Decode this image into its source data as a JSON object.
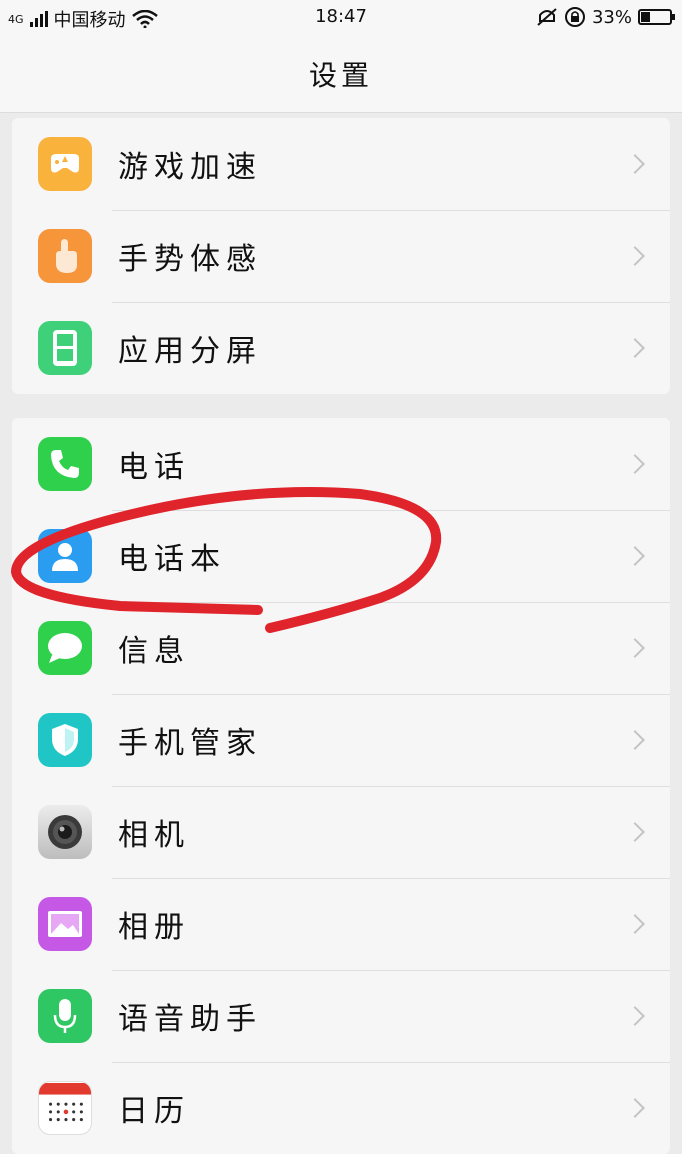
{
  "status": {
    "network": "4G",
    "carrier": "中国移动",
    "time": "18:47",
    "battery": "33%",
    "battery_level": 0.33
  },
  "nav": {
    "title": "设置"
  },
  "groups": [
    {
      "items": [
        {
          "label": "游戏加速",
          "icon": "game-rocket-icon",
          "color": "#f9b23c"
        },
        {
          "label": "手势体感",
          "icon": "hand-gesture-icon",
          "color": "#f7953b"
        },
        {
          "label": "应用分屏",
          "icon": "split-screen-icon",
          "color": "#3ed17a"
        }
      ]
    },
    {
      "items": [
        {
          "label": "电话",
          "icon": "phone-icon",
          "color": "#2fd04c"
        },
        {
          "label": "电话本",
          "icon": "contacts-icon",
          "color": "#2b9df0"
        },
        {
          "label": "信息",
          "icon": "message-icon",
          "color": "#2fd04c"
        },
        {
          "label": "手机管家",
          "icon": "shield-icon",
          "color": "#20c6c6"
        },
        {
          "label": "相机",
          "icon": "camera-icon",
          "color": "#c9c9c9"
        },
        {
          "label": "相册",
          "icon": "gallery-icon",
          "color": "#c658e6"
        },
        {
          "label": "语音助手",
          "icon": "microphone-icon",
          "color": "#2fc764"
        },
        {
          "label": "日历",
          "icon": "calendar-icon",
          "color": "#ffffff"
        }
      ]
    }
  ],
  "annotation_color": "#e0242c"
}
